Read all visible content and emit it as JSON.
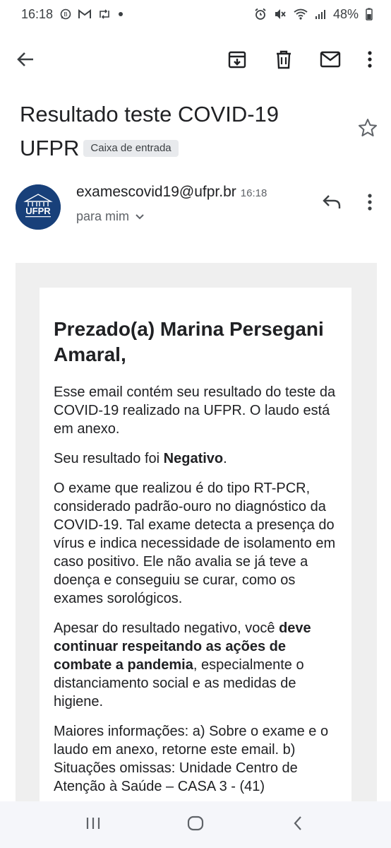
{
  "status_bar": {
    "time": "16:18",
    "battery": "48%",
    "left_icons": [
      "whatsapp-icon",
      "gmail-icon",
      "retweet-icon",
      "dot-icon"
    ],
    "right_icons": [
      "alarm-icon",
      "mute-icon",
      "wifi-icon",
      "signal-icon"
    ]
  },
  "toolbar": {
    "icons": [
      "back-arrow-icon",
      "archive-icon",
      "delete-icon",
      "mark-unread-icon",
      "more-vert-icon"
    ]
  },
  "email": {
    "subject": "Resultado teste COVID-19 UFPR",
    "label": "Caixa de entrada",
    "sender": "examescovid19@ufpr.br",
    "time": "16:18",
    "recipient": "para mim",
    "avatar_text": "UFPR",
    "body": {
      "greeting": "Prezado(a) Marina Persegani Amaral,",
      "p1": "Esse email contém seu resultado do teste da COVID-19 realizado na UFPR. O laudo está em anexo.",
      "p2_prefix": "Seu resultado foi ",
      "p2_bold": "Negativo",
      "p2_suffix": ".",
      "p3": "O exame que realizou é do tipo RT-PCR, considerado padrão-ouro no diagnóstico da COVID-19. Tal exame detecta a presença do vírus e indica necessidade de isolamento em caso positivo. Ele não avalia se já teve a doença e conseguiu se curar, como os exames sorológicos.",
      "p4_prefix": "Apesar do resultado negativo, você ",
      "p4_bold": "deve continuar respeitando as ações de combate a pandemia",
      "p4_suffix": ", especialmente o distanciamento social e as medidas de higiene.",
      "p5": "Maiores informações: a) Sobre o exame e o laudo em anexo, retorne este email. b) Situações omissas: Unidade Centro de Atenção à Saúde – CASA 3 - (41)"
    }
  },
  "nav_bar": {
    "icons": [
      "recent-apps-icon",
      "home-icon",
      "back-icon"
    ]
  },
  "colors": {
    "text": "#202124",
    "secondary_text": "#5f6368",
    "chip_bg": "#e8eaed",
    "outer_card_bg": "#efefef",
    "avatar_bg": "#18407a"
  }
}
